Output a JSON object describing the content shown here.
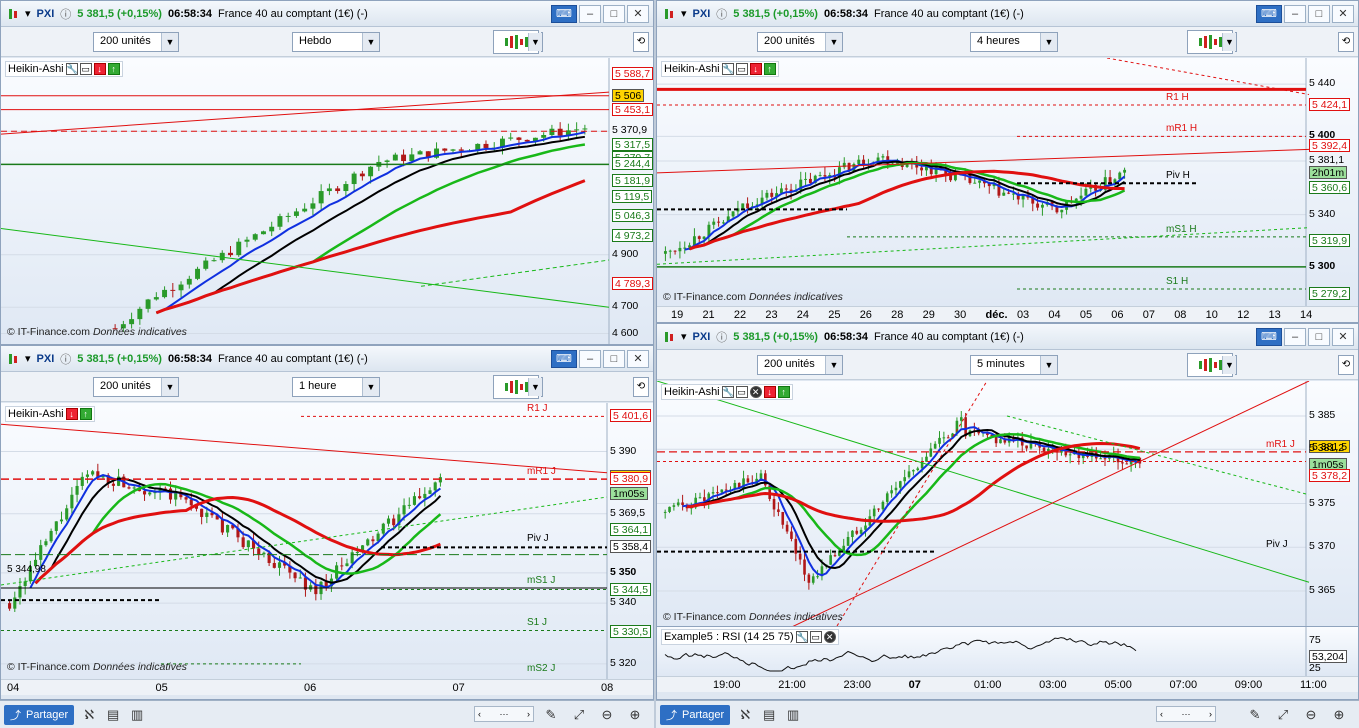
{
  "colors": {
    "up": "#2a9a2a",
    "down": "#b01818",
    "blue": "#1030e0",
    "black": "#000000",
    "green": "#18b818",
    "red": "#e01010",
    "resistance": "#e01010",
    "support": "#1a7a1a",
    "accent": "#2e6fc4"
  },
  "header": {
    "symbol": "PXI",
    "price": "5 381,5 (+0,15%)",
    "time": "06:58:34",
    "name": "France 40 au comptant (1€) (-)"
  },
  "bottom": {
    "share_label": "Partager"
  },
  "windows": [
    {
      "id": "w1",
      "units": "200 unités",
      "period": "Hebdo",
      "indicator": "Heikin-Ashi",
      "copyright": "© IT-Finance.com",
      "copyright_note": "Données indicatives",
      "ymin": 4560,
      "ymax": 5650,
      "yticks": [
        {
          "v": 5588.7,
          "t": "5 588,7",
          "c": "#e01010",
          "box": true
        },
        {
          "v": 5506,
          "t": "5 506",
          "c": "#000",
          "box": true,
          "bg": "#ffd400"
        },
        {
          "v": 5453.1,
          "t": "5 453,1",
          "c": "#e01010",
          "box": true
        },
        {
          "v": 5370.9,
          "t": "5 370,9",
          "c": "#000",
          "box": false
        },
        {
          "v": 5317.5,
          "t": "5 317,5",
          "c": "#1a7a1a",
          "box": true
        },
        {
          "v": 5270.7,
          "t": "5 270,7",
          "c": "#1a7a1a",
          "box": true
        },
        {
          "v": 5244.4,
          "t": "5 244,4",
          "c": "#1a7a1a",
          "box": true
        },
        {
          "v": 5181.9,
          "t": "5 181,9",
          "c": "#1a7a1a",
          "box": true
        },
        {
          "v": 5119.5,
          "t": "5 119,5",
          "c": "#1a7a1a",
          "box": true
        },
        {
          "v": 5046.3,
          "t": "5 046,3",
          "c": "#1a7a1a",
          "box": true
        },
        {
          "v": 4973.2,
          "t": "4 973,2",
          "c": "#1a7a1a",
          "box": true
        },
        {
          "v": 4900,
          "t": "4 900",
          "c": "#000",
          "box": false
        },
        {
          "v": 4789.3,
          "t": "4 789,3",
          "c": "#e01010",
          "box": true
        },
        {
          "v": 4700,
          "t": "4 700",
          "c": "#000",
          "box": false
        },
        {
          "v": 4600,
          "t": "4 600",
          "c": "#000",
          "box": false
        }
      ],
      "xlabels": [],
      "levels": []
    },
    {
      "id": "w2",
      "units": "200 unités",
      "period": "4 heures",
      "indicator": "Heikin-Ashi",
      "copyright": "© IT-Finance.com",
      "copyright_note": "Données indicatives",
      "ymin": 5270,
      "ymax": 5460,
      "yticks": [
        {
          "v": 5440,
          "t": "5 440",
          "c": "#000",
          "box": false
        },
        {
          "v": 5424.1,
          "t": "5 424,1",
          "c": "#e01010",
          "box": true
        },
        {
          "v": 5400,
          "t": "5 400",
          "c": "#000",
          "box": false,
          "bold": true
        },
        {
          "v": 5392.4,
          "t": "5 392,4",
          "c": "#e01010",
          "box": true
        },
        {
          "v": 5381.1,
          "t": "5 381,1",
          "c": "#000",
          "box": false
        },
        {
          "v": 5372,
          "t": "2h01m",
          "c": "#000",
          "box": true,
          "bg": "#9be09b"
        },
        {
          "v": 5360.6,
          "t": "5 360,6",
          "c": "#1a7a1a",
          "box": true
        },
        {
          "v": 5340,
          "t": "5 340",
          "c": "#000",
          "box": false
        },
        {
          "v": 5319.9,
          "t": "5 319,9",
          "c": "#1a7a1a",
          "box": true
        },
        {
          "v": 5300,
          "t": "5 300",
          "c": "#000",
          "box": false,
          "bold": true
        },
        {
          "v": 5279.2,
          "t": "5 279,2",
          "c": "#1a7a1a",
          "box": true
        }
      ],
      "xlabels": [
        "19",
        "21",
        "22",
        "23",
        "24",
        "25",
        "26",
        "28",
        "29",
        "30",
        "déc.",
        "03",
        "04",
        "05",
        "06",
        "07",
        "08",
        "10",
        "12",
        "13",
        "14"
      ],
      "levels": [
        {
          "t": "R1 H",
          "v": 5424
        },
        {
          "t": "mR1 H",
          "v": 5400
        },
        {
          "t": "Piv H",
          "v": 5364
        },
        {
          "t": "mS1 H",
          "v": 5323
        },
        {
          "t": "S1 H",
          "v": 5283
        }
      ]
    },
    {
      "id": "w3",
      "units": "200 unités",
      "period": "1 heure",
      "indicator": "Heikin-Ashi",
      "copyright": "© IT-Finance.com",
      "copyright_note": "Données indicatives",
      "ymin": 5315,
      "ymax": 5406,
      "yticks": [
        {
          "v": 5401.6,
          "t": "5 401,6",
          "c": "#e01010",
          "box": true
        },
        {
          "v": 5390,
          "t": "5 390",
          "c": "#000",
          "box": false
        },
        {
          "v": 5381.5,
          "t": "5 381,5",
          "c": "#000",
          "box": true,
          "bg": "#ffd400"
        },
        {
          "v": 5380.9,
          "t": "5 380,9",
          "c": "#e01010",
          "box": true
        },
        {
          "v": 5376,
          "t": "1m05s",
          "c": "#000",
          "box": true,
          "bg": "#9be09b"
        },
        {
          "v": 5369.5,
          "t": "5 369,5",
          "c": "#000",
          "box": false
        },
        {
          "v": 5364.1,
          "t": "5 364,1",
          "c": "#1a7a1a",
          "box": true
        },
        {
          "v": 5358.4,
          "t": "5 358,4",
          "c": "#000",
          "box": true
        },
        {
          "v": 5350,
          "t": "5 350",
          "c": "#000",
          "box": false,
          "bold": true
        },
        {
          "v": 5344.5,
          "t": "5 344,5",
          "c": "#1a7a1a",
          "box": true
        },
        {
          "v": 5340,
          "t": "5 340",
          "c": "#000",
          "box": false
        },
        {
          "v": 5330.5,
          "t": "5 330,5",
          "c": "#1a7a1a",
          "box": true
        },
        {
          "v": 5320,
          "t": "5 320",
          "c": "#000",
          "box": false
        }
      ],
      "xlabels": [
        "04",
        "05",
        "06",
        "07",
        "08"
      ],
      "price_note": "5 344,98",
      "levels": [
        {
          "t": "R1 J",
          "v": 5401.6
        },
        {
          "t": "mR1 J",
          "v": 5380.9
        },
        {
          "t": "Piv J",
          "v": 5359
        },
        {
          "t": "mS1 J",
          "v": 5345
        },
        {
          "t": "S1 J",
          "v": 5331
        },
        {
          "t": "mS2 J",
          "v": 5316
        }
      ]
    },
    {
      "id": "w4",
      "units": "200 unités",
      "period": "5 minutes",
      "indicator": "Heikin-Ashi",
      "copyright": "© IT-Finance.com",
      "copyright_note": "Données indicatives",
      "ymin": 5361,
      "ymax": 5389,
      "yticks": [
        {
          "v": 5385,
          "t": "5 385",
          "c": "#000",
          "box": false
        },
        {
          "v": 5381.5,
          "t": "5 381,5",
          "c": "#000",
          "box": true,
          "bg": "#ffd400"
        },
        {
          "v": 5381.2,
          "t": "5 381,2",
          "c": "#000",
          "box": false
        },
        {
          "v": 5379.4,
          "t": "1m05s",
          "c": "#000",
          "box": true,
          "bg": "#9be09b"
        },
        {
          "v": 5378.2,
          "t": "5 378,2",
          "c": "#e01010",
          "box": true
        },
        {
          "v": 5375,
          "t": "5 375",
          "c": "#000",
          "box": false
        },
        {
          "v": 5370,
          "t": "5 370",
          "c": "#000",
          "box": false
        },
        {
          "v": 5365,
          "t": "5 365",
          "c": "#000",
          "box": false
        }
      ],
      "xlabels": [
        "19:00",
        "21:00",
        "23:00",
        "07",
        "01:00",
        "03:00",
        "05:00",
        "07:00",
        "09:00",
        "11:00"
      ],
      "levels": [
        {
          "t": "mR1 J",
          "v": 5380.9
        },
        {
          "t": "Piv J",
          "v": 5369.5
        }
      ],
      "rsi": {
        "label": "Example5 : RSI (14 25 75)",
        "value": "53,204",
        "hi": "75",
        "lo": "25"
      }
    }
  ]
}
